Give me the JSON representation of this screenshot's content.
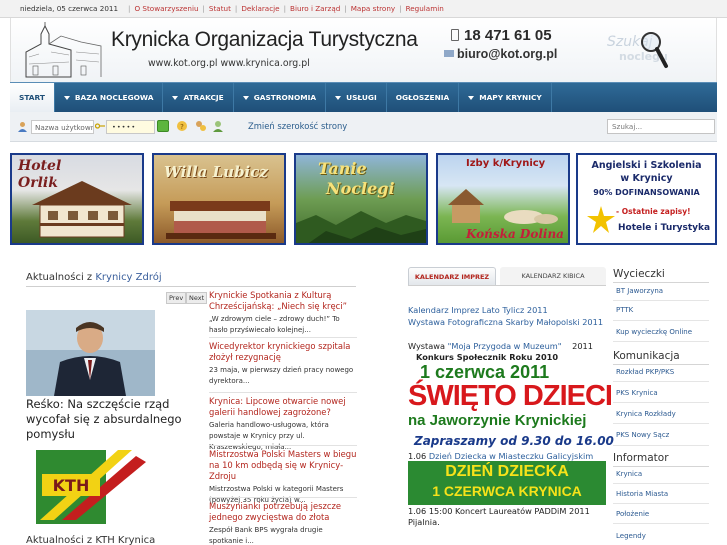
{
  "topbar": {
    "date": "niedziela, 05 czerwca 2011",
    "links": [
      "O Stowarzyszeniu",
      "Statut",
      "Deklaracje",
      "Biuro i Zarząd",
      "Mapa strony",
      "Regulamin"
    ]
  },
  "header": {
    "title": "Krynicka Organizacja Turystyczna",
    "urls": "www.kot.org.pl   www.krynica.org.pl",
    "phone": "18 471 61 05",
    "email": "biuro@kot.org.pl",
    "search_logo_1": "Szukaj",
    "search_logo_2": "noclegu"
  },
  "nav": [
    {
      "label": "START",
      "dropdown": false
    },
    {
      "label": "BAZA NOCLEGOWA",
      "dropdown": true
    },
    {
      "label": "ATRAKCJE",
      "dropdown": true
    },
    {
      "label": "GASTRONOMIA",
      "dropdown": true
    },
    {
      "label": "USŁUGI",
      "dropdown": true
    },
    {
      "label": "OGŁOSZENIA",
      "dropdown": false
    },
    {
      "label": "MAPY KRYNICY",
      "dropdown": true
    }
  ],
  "login": {
    "user_placeholder": "Nazwa użytkownika",
    "password_mask": "•••••",
    "change_width": "Zmień szerokość strony",
    "search_placeholder": "Szukaj..."
  },
  "banners": {
    "hotel_1": "Hotel",
    "hotel_2": "Orlik",
    "willa": "Willa Lubicz",
    "tanie_1": "Tanie",
    "tanie_2": "Noclegi",
    "izby": "Izby k/Krynicy",
    "konska": "Końska Dolina",
    "ang_1": "Angielski i Szkolenia",
    "ang_2": "w Krynicy",
    "ang_3": "90% DOFINANSOWANIA",
    "ang_4": "- Ostatnie zapisy!",
    "ang_5": "Hotele i Turystyka"
  },
  "main": {
    "heading_prefix": "Aktualności z",
    "heading_link": "Krynicy Zdrój",
    "prev": "Prev",
    "next": "Next",
    "lead_title": "Reśko: Na szczęście rząd wycofał się z absurdalnego pomysłu",
    "kth_heading": "Aktualności z KTH Krynica",
    "kth_logo_text": "KTH",
    "news": [
      {
        "title": "Krynickie Spotkania z Kulturą Chrześcijańską: „Niech się kręci”",
        "text": "„W zdrowym ciele – zdrowy duch!” To hasło przyświecało kolejnej..."
      },
      {
        "title": "Wicedyrektor krynickiego szpitala złożył rezygnację",
        "text": "23 maja, w pierwszy dzień pracy nowego dyrektora..."
      },
      {
        "title": "Krynica: Lipcowe otwarcie nowej galerii handlowej zagrożone?",
        "text": "Galeria handlowo-usługowa, która powstaje w Krynicy przy ul. Kraszewskiego, miała..."
      },
      {
        "title": "Mistrzostwa Polski Masters w biegu na 10 km odbędą się w Krynicy-Zdroju",
        "text": "Mistrzostwa Polski w kategorii Masters (powyżej 35 roku życia) w..."
      },
      {
        "title": "Muszynianki potrzebują jeszcze jednego zwycięstwa do złota",
        "text": "Zespół Bank BPS wygrała drugie spotkanie i..."
      }
    ]
  },
  "calendar": {
    "tab_active": "KALENDARZ IMPREZ",
    "tab_inactive": "KALENDARZ KIBICA",
    "link_1": "Kalendarz Imprez Lato Tylicz 2011",
    "link_2": "Wystawa Fotograficzna Skarby Małopolski 2011",
    "line_3_prefix": "Wystawa",
    "line_3_link": "\"Moja Przygoda w Muzeum\"",
    "line_3_suffix": "2011",
    "konkurs": "Konkurs Społecznik Roku 2010",
    "swieto_date": "1 czerwca 2011",
    "swieto_1": "ŚWIĘTO DZIECI",
    "swieto_2": "na Jaworzynie Krynickiej",
    "swieto_3": "Zapraszamy od 9.30 do 16.00",
    "item_1_date": "1.06",
    "item_1_link": "Dzień Dziecka w Miasteczku Galicyjskim",
    "dzien_1": "DZIEŃ DZIECKA",
    "dzien_2": "1 CZERWCA KRYNICA",
    "item_2": "1.06 15:00 Koncert Laureatów PADDiM 2011",
    "item_2b": "Pijalnia."
  },
  "right": {
    "sections": [
      {
        "title": "Wycieczki",
        "items": [
          "BT Jaworzyna",
          "PTTK",
          "Kup wycieczkę Online"
        ]
      },
      {
        "title": "Komunikacja",
        "items": [
          "Rozkład PKP/PKS",
          "PKS Krynica",
          "Krynica Rozkłady",
          "PKS Nowy Sącz"
        ]
      },
      {
        "title": "Informator",
        "items": [
          "Krynica",
          "Historia Miasta",
          "Położenie",
          "Legendy"
        ]
      }
    ]
  },
  "colors": {
    "nav_bg": "#1f4f78",
    "news_title": "#b3261e",
    "link": "#2c5f9c",
    "banner_border": "#1a3a8a"
  }
}
